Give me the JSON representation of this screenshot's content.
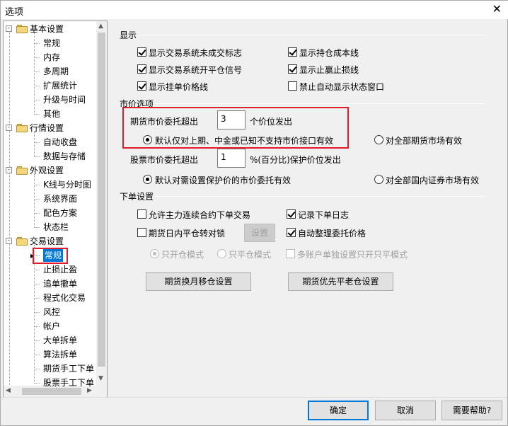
{
  "window": {
    "title": "选项",
    "close_glyph": "✕"
  },
  "tree": {
    "groups": [
      {
        "label": "基本设置",
        "expander": "-",
        "items": [
          "常规",
          "内存",
          "多周期",
          "扩展统计",
          "升级与时间",
          "其他"
        ]
      },
      {
        "label": "行情设置",
        "expander": "-",
        "items": [
          "自动收盘",
          "数据与存储"
        ]
      },
      {
        "label": "外观设置",
        "expander": "-",
        "items": [
          "K线与分时图",
          "系统界面",
          "配色方案",
          "状态栏"
        ]
      },
      {
        "label": "交易设置",
        "expander": "-",
        "items": [
          "常规",
          "止损止盈",
          "追单撤单",
          "程式化交易",
          "风控",
          "帐户",
          "大单拆单",
          "算法拆单",
          "期货手工下单",
          "股票手工下单"
        ]
      }
    ],
    "selected_indicator": "▸"
  },
  "display": {
    "title": "显示",
    "options": [
      {
        "label": "显示交易系统未成交标志",
        "checked": true
      },
      {
        "label": "显示持仓成本线",
        "checked": true
      },
      {
        "label": "显示交易系统开平仓信号",
        "checked": true
      },
      {
        "label": "显示止赢止损线",
        "checked": true
      },
      {
        "label": "显示挂单价格线",
        "checked": true
      },
      {
        "label": "禁止自动显示状态窗口",
        "checked": false
      }
    ]
  },
  "market_price": {
    "title": "市价选项",
    "futures_label": "期货市价委托超出",
    "futures_value": "3",
    "futures_suffix": "个价位发出",
    "futures_radio_1": "默认仅对上期、中金或已知不支持市价接口有效",
    "futures_radio_2": "对全部期货市场有效",
    "stock_label": "股票市价委托超出",
    "stock_value": "1",
    "stock_suffix": "%(百分比)保护价位发出",
    "stock_radio_1": "默认对需设置保护价的市价委托有效",
    "stock_radio_2": "对全部国内证券市场有效"
  },
  "order": {
    "title": "下单设置",
    "allow_main_contract": "允许主力连续合约下单交易",
    "log_orders": "记录下单日志",
    "intraday_close_lock": "期货日内平仓转对锁",
    "settings_button": "设置",
    "auto_adjust_price": "自动整理委托价格",
    "open_only_mode": "只开仓模式",
    "close_only_mode": "只平仓模式",
    "multi_account_mode": "多账户单独设置只开只平模式",
    "futures_rollover_button": "期货换月移仓设置",
    "futures_priority_close_button": "期货优先平老仓设置"
  },
  "buttons": {
    "ok": "确定",
    "cancel": "取消",
    "help": "需要帮助?"
  },
  "colors": {
    "highlight_box": "#e41b2c",
    "selected_bg": "#0078d7"
  }
}
